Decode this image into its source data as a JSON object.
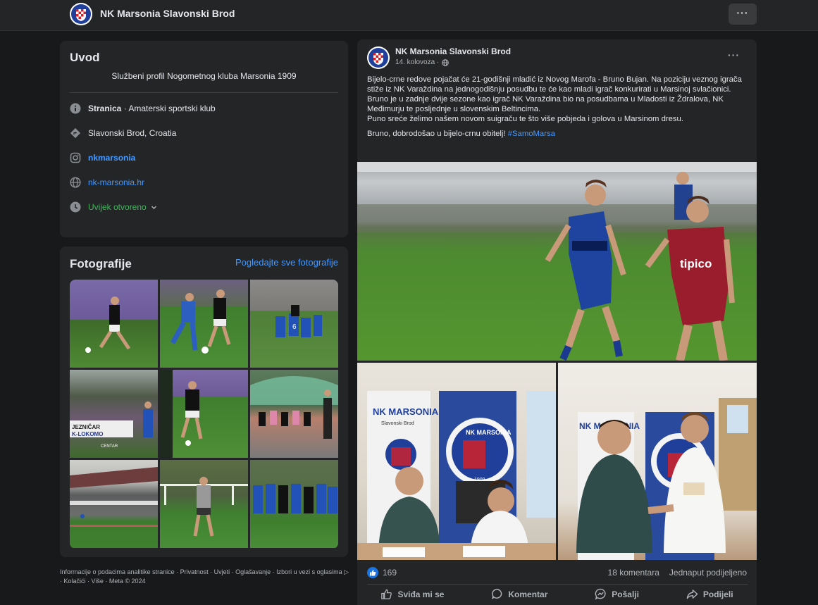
{
  "topbar": {
    "page_name": "NK Marsonia Slavonski Brod",
    "more_label": "···"
  },
  "intro": {
    "title": "Uvod",
    "bio": "Službeni profil Nogometnog kluba Marsonia 1909",
    "category_bold": "Stranica",
    "category_rest": " · Amaterski sportski klub",
    "location": "Slavonski Brod, Croatia",
    "instagram": "nkmarsonia",
    "website": "nk-marsonia.hr",
    "hours": "Uvijek otvoreno"
  },
  "photos": {
    "title": "Fotografije",
    "see_all": "Pogledajte sve fotografije",
    "banner_text": "JEZNIČAR",
    "banner_text2": "K-LOKOMO",
    "banner_text3": "CENTAR"
  },
  "footer": {
    "text": "Informacije o podacima analitike stranice · Privatnost · Uvjeti · Oglašavanje · Izbori u vezi s oglasima ▷ · Kolačići · Više · Meta © 2024"
  },
  "post": {
    "author": "NK Marsonia Slavonski Brod",
    "date": "14. kolovoza ·",
    "more_label": "···",
    "para1": "Bijelo-crne redove pojačat će 21-godišnji mladić iz Novog Marofa - Bruno Bujan. Na poziciju veznog igrača stiže iz NK Varaždina na jednogodišnju posudbu te će kao mladi igrač konkurirati u Marsinoj svlačionici.",
    "para2": "Bruno je u zadnje dvije sezone kao igrač NK Varaždina bio na posudbama u Mladosti iz Ždralova, NK Međimurju te posljednje u slovenskim Beltincima.",
    "para3": "Puno sreće želimo našem novom suigraču te što više pobjeda i golova u Marsinom dresu.",
    "para4": "Bruno, dobrodošao u bijelo-crnu obitelj! ",
    "hashtag": "#SamoMarsa",
    "banner_title": "NK MARSONIA",
    "banner_sub": "Slavonski Brod",
    "crest_text": "NK MARSONIA",
    "crest_year": "1909",
    "shirt_sponsor": "tipico",
    "reaction_count": "169",
    "comments": "18 komentara",
    "shares": "Jednaput podijeljeno",
    "actions": {
      "like": "Sviđa mi se",
      "comment": "Komentar",
      "send": "Pošalji",
      "share": "Podijeli"
    }
  },
  "colors": {
    "accent": "#4599ff",
    "background": "#18191a",
    "card": "#242526",
    "green": "#41b35d"
  }
}
